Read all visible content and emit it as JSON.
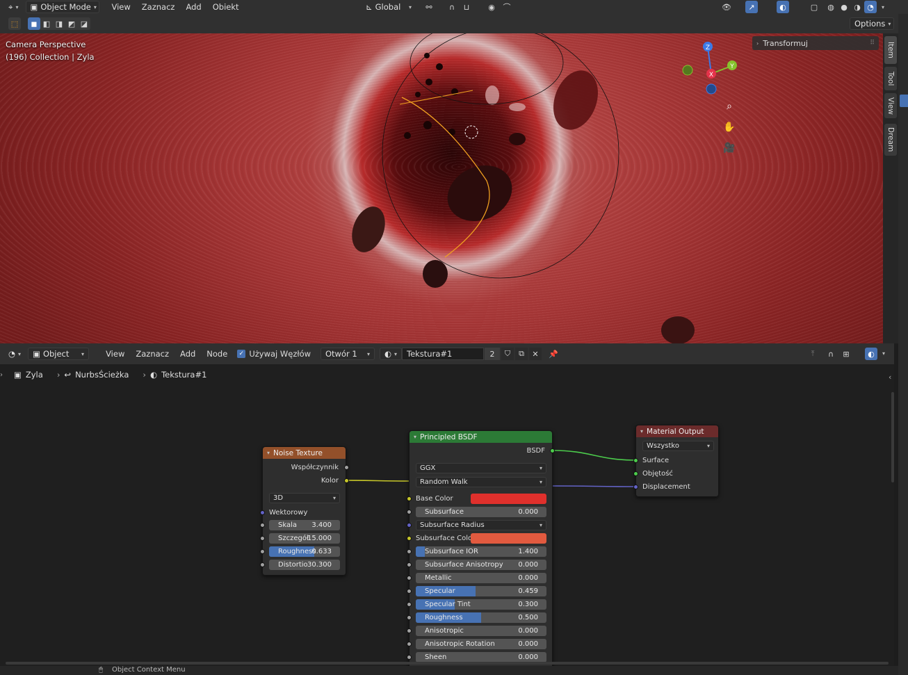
{
  "topbar": {
    "mode_label": "Object Mode",
    "menus": [
      "View",
      "Zaznacz",
      "Add",
      "Obiekt"
    ],
    "transform_orientation": "Global"
  },
  "viewport": {
    "options_label": "Options",
    "camera_text": "Camera Perspective",
    "collection_text": "(196) Collection | Zyla",
    "transform_panel_label": "Transformuj",
    "sidebar_tabs": [
      "Item",
      "Tool",
      "View",
      "Dream"
    ],
    "gizmo_axes": {
      "z": "Z",
      "y": "Y",
      "x": "X"
    },
    "colors": {
      "gizmo_x": "#e5334a",
      "gizmo_y": "#86c22d",
      "gizmo_z": "#3b7ae8"
    }
  },
  "node_editor": {
    "header": {
      "editor_type": "Object",
      "menus": [
        "View",
        "Zaznacz",
        "Add",
        "Node"
      ],
      "use_nodes_label": "Używaj Węzłów",
      "slot_label": "Otwór 1",
      "material_name": "Tekstura#1",
      "user_count": "2"
    },
    "breadcrumb": [
      "Zyla",
      "NurbsŚcieżka",
      "Tekstura#1"
    ],
    "noise_node": {
      "title": "Noise Texture",
      "outputs": [
        "Współczynnik",
        "Kolor"
      ],
      "dimension": "3D",
      "vector_label": "Wektorowy",
      "fields": [
        {
          "label": "Skala",
          "value": "3.400",
          "fill": 0
        },
        {
          "label": "Szczegół",
          "value": "15.000",
          "fill": 0
        },
        {
          "label": "Roughness",
          "value": "0.633",
          "fill": 0.633
        },
        {
          "label": "Distortio",
          "value": "30.300",
          "fill": 0
        }
      ]
    },
    "bsdf_node": {
      "title": "Principled BSDF",
      "output": "BSDF",
      "distribution": "GGX",
      "subsurface_method": "Random Walk",
      "base_color_label": "Base Color",
      "base_color": "#e0302c",
      "subsurface_label": {
        "label": "Subsurface",
        "value": "0.000",
        "fill": 0
      },
      "subsurface_radius_label": "Subsurface Radius",
      "subsurface_color_label": "Subsurface Color",
      "subsurface_color": "#e25a3f",
      "fields": [
        {
          "label": "Subsurface IOR",
          "value": "1.400",
          "fill": 0.07
        },
        {
          "label": "Subsurface Anisotropy",
          "value": "0.000",
          "fill": 0
        },
        {
          "label": "Metallic",
          "value": "0.000",
          "fill": 0
        },
        {
          "label": "Specular",
          "value": "0.459",
          "fill": 0.459
        },
        {
          "label": "Specular Tint",
          "value": "0.300",
          "fill": 0.3
        },
        {
          "label": "Roughness",
          "value": "0.500",
          "fill": 0.5
        },
        {
          "label": "Anisotropic",
          "value": "0.000",
          "fill": 0
        },
        {
          "label": "Anisotropic Rotation",
          "value": "0.000",
          "fill": 0
        },
        {
          "label": "Sheen",
          "value": "0.000",
          "fill": 0
        }
      ]
    },
    "output_node": {
      "title": "Material Output",
      "target": "Wszystko",
      "inputs": [
        "Surface",
        "Objętość",
        "Displacement"
      ]
    }
  },
  "statusbar": {
    "context_menu_label": "Object Context Menu"
  }
}
